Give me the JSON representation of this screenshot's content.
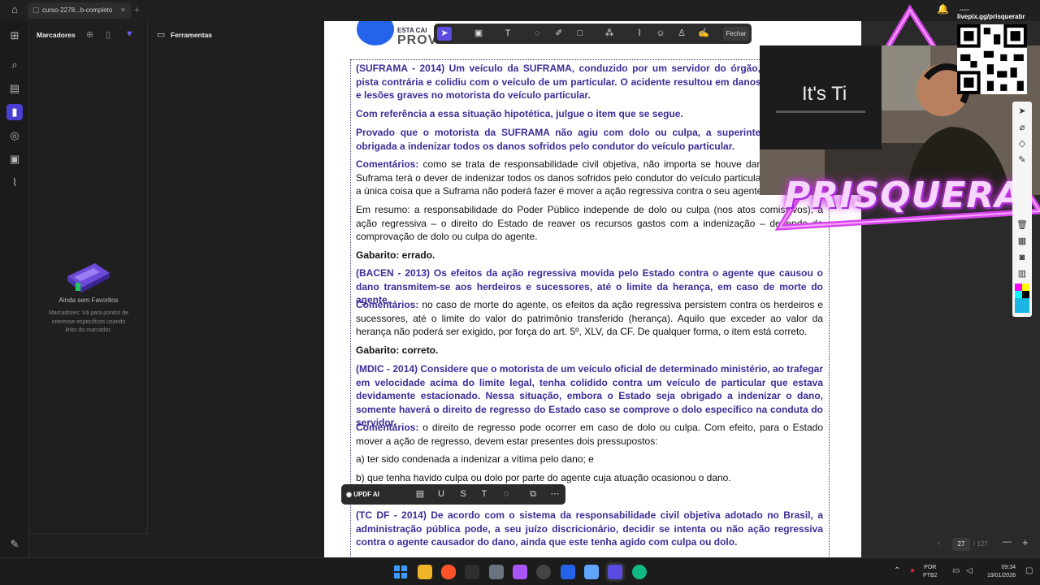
{
  "titlebar": {
    "tab_title": "curso-2278...b-completo",
    "tab_close": "×",
    "new_tab": "+"
  },
  "left_panel": {
    "title": "Marcadores",
    "empty_title": "Ainda sem Favoritos",
    "empty_desc": "Marcadores: Vá para pontos de interesse específicos usando links do marcador."
  },
  "tools_panel": {
    "title": "Ferramentas"
  },
  "annotation_toolbar": {
    "close_label": "Fechar"
  },
  "selection_toolbar": {
    "ai_label": "UPDF AI"
  },
  "doc": {
    "logo_line1": "ESTA CAI",
    "logo_line2": "PROV",
    "q1": "(SUFRAMA - 2014) Um veículo da SUFRAMA, conduzido por um servidor do órgão, derrapou na pista contrária e colidiu com o veículo de um particular. O acidente resultou em danos aos veículos e lesões graves no motorista do veículo particular.",
    "q1b": "Com referência a essa situação hipotética, julgue o item que se segue.",
    "q1c": "Provado que o motorista da SUFRAMA não agiu com dolo ou culpa, a superintendência será obrigada a indenizar todos os danos sofridos pelo condutor do veículo particular.",
    "c1_label": "Comentários:",
    "c1": " como se trata de responsabilidade civil objetiva, não importa se houve dano ou culpa. A Suframa terá o dever de indenizar todos os danos sofridos pelo condutor do veículo particular. Nesse caso, a única coisa que a Suframa não poderá fazer é mover a ação regressiva contra o seu agente.",
    "r1": "Em resumo: a responsabilidade do Poder Público independe de dolo ou culpa (nos atos comissivos); a ação regressiva – o direito do Estado de reaver os recursos gastos com a indenização – depende da comprovação de dolo ou culpa do agente.",
    "g1": "Gabarito: errado.",
    "q2": "(BACEN - 2013) Os efeitos da ação regressiva movida pelo Estado contra o agente que causou o dano transmitem-se aos herdeiros e sucessores, até o limite da herança, em caso de morte do agente.",
    "c2_label": "Comentários:",
    "c2": " no caso de morte do agente, os efeitos da ação regressiva persistem contra os herdeiros e sucessores, até o limite do valor do patrimônio transferido (herança). Aquilo que exceder ao valor da herança não poderá ser exigido, por força do art. 5º, XLV, da CF. De qualquer forma, o item está correto.",
    "g2": "Gabarito: correto.",
    "q3": "(MDIC - 2014) Considere que o motorista de um veículo oficial de determinado ministério, ao trafegar em velocidade acima do limite legal, tenha colidido contra um veículo de particular que estava devidamente estacionado. Nessa situação, embora o Estado seja obrigado a indenizar o dano, somente haverá o direito de regresso do Estado caso se comprove o dolo específico na conduta do servidor.",
    "c3_label": "Comentários:",
    "c3": " o direito de regresso pode ocorrer em caso de dolo ou culpa. Com efeito, para o Estado mover a ação de regresso, devem estar presentes dois pressupostos:",
    "c3a": "a) ter sido condenada a indenizar a vítima pelo dano; e",
    "c3b": "b) que tenha havido culpa ou dolo por parte do agente cuja atuação ocasionou o dano.",
    "q4": "(TC DF - 2014) De acordo com o sistema da responsabilidade civil objetiva adotado no Brasil, a administração pública pode, a seu juízo discricionário, decidir se intenta ou não ação regressiva contra o agente causador do dano, ainda que este tenha agido com culpa ou dolo."
  },
  "page_nav": {
    "current": "27",
    "total": "/ 127"
  },
  "overlay": {
    "qr_url": "livepix.gg/prisquerabr",
    "its_text": "It's Ti",
    "streamer": "PRISQUERA"
  },
  "taskbar": {
    "lang1": "POR",
    "lang2": "PTB2",
    "time": "09:34",
    "date": "19/01/2026"
  },
  "colors": {
    "accent": "#5b4be0",
    "question_text": "#3b2d97"
  }
}
